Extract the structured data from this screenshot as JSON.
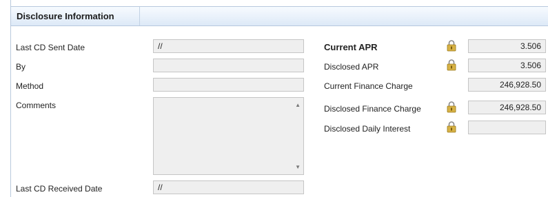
{
  "section": {
    "title": "Disclosure Information"
  },
  "left": {
    "last_cd_sent_label": "Last CD Sent Date",
    "last_cd_sent_value": "//",
    "by_label": "By",
    "by_value": "",
    "method_label": "Method",
    "method_value": "",
    "comments_label": "Comments",
    "comments_value": "",
    "last_cd_received_label": "Last CD Received Date",
    "last_cd_received_value": "//"
  },
  "right": {
    "current_apr_label": "Current APR",
    "current_apr_value": "3.506",
    "disclosed_apr_label": "Disclosed APR",
    "disclosed_apr_value": "3.506",
    "current_finance_charge_label": "Current Finance Charge",
    "current_finance_charge_value": "246,928.50",
    "disclosed_finance_charge_label": "Disclosed Finance Charge",
    "disclosed_finance_charge_value": "246,928.50",
    "disclosed_daily_interest_label": "Disclosed Daily Interest",
    "disclosed_daily_interest_value": ""
  },
  "icons": {
    "lock": "lock-icon",
    "scroll_up": "scroll-up-arrow",
    "scroll_down": "scroll-down-arrow"
  },
  "colors": {
    "header_bg": "#dde9f7",
    "field_bg": "#efefef",
    "lock_gold": "#d7b245"
  }
}
